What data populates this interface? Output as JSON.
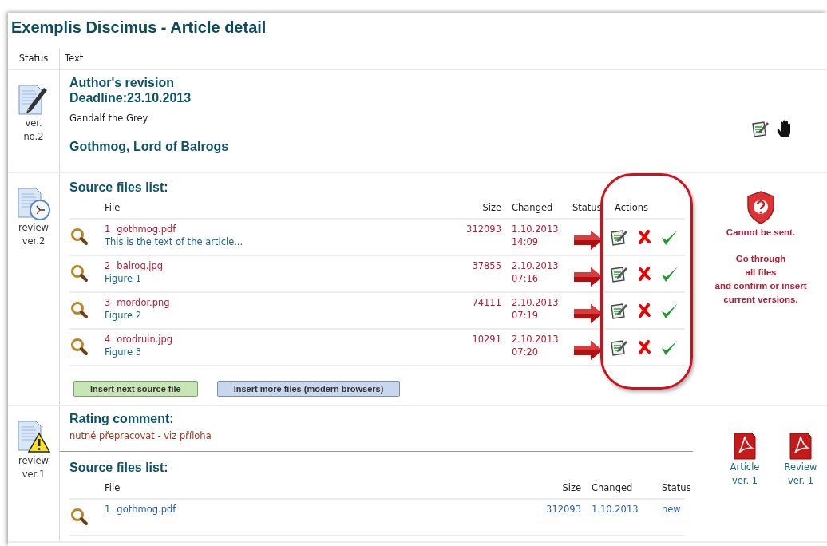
{
  "page_title": "Exemplis Discimus - Article detail",
  "columns": [
    "Status",
    "Text"
  ],
  "sections": [
    {
      "kind": "revision",
      "status_label": "ver. no.2",
      "heading_lines": [
        "Author's revision",
        "Deadline:23.10.2013"
      ],
      "author": "Gandalf the Grey",
      "article_title": "Gothmog, Lord of Balrogs"
    },
    {
      "kind": "review",
      "status_label": "review ver.2",
      "files_heading": "Source files list:",
      "files": {
        "kind": "editable",
        "columns": [
          "File",
          "Size",
          "Changed",
          "Status",
          "Actions"
        ],
        "highlight_actions": true,
        "rows": [
          {
            "number": "1",
            "name": "gothmog.pdf",
            "description": "This is the text of the article...",
            "size": "312093",
            "date": "1.10.2013",
            "time": "14:09",
            "flagged": true
          },
          {
            "number": "2",
            "name": "balrog.jpg",
            "description": "Figure 1",
            "size": "37855",
            "date": "2.10.2013",
            "time": "07:16",
            "flagged": true
          },
          {
            "number": "3",
            "name": "mordor.png",
            "description": "Figure 2",
            "size": "74111",
            "date": "2.10.2013",
            "time": "07:19",
            "flagged": true
          },
          {
            "number": "4",
            "name": "orodruin.jpg",
            "description": "Figure 3",
            "size": "10291",
            "date": "2.10.2013",
            "time": "07:20",
            "flagged": true
          }
        ]
      },
      "buttons": [
        {
          "label": "Insert next source file",
          "kind": "primary"
        },
        {
          "label": "Insert more files (modern browsers)",
          "kind": "secondary"
        }
      ],
      "notice": {
        "title": "Cannot be sent.",
        "lines": [
          "Go through",
          "all files",
          "and confirm or insert",
          "current versions."
        ]
      }
    },
    {
      "kind": "rating",
      "status_label": "review ver.1",
      "comment_heading": "Rating comment:",
      "comment": "nutné přepracovat - viz příloha",
      "files_heading": "Source files list:",
      "files": {
        "kind": "readonly",
        "columns": [
          "File",
          "Size",
          "Changed",
          "Status"
        ],
        "rows": [
          {
            "number": "1",
            "name": "gothmog.pdf",
            "size": "312093",
            "date": "1.10.2013",
            "status": "new"
          }
        ]
      },
      "documents": [
        "Article ver. 1",
        "Review ver. 1"
      ]
    }
  ]
}
